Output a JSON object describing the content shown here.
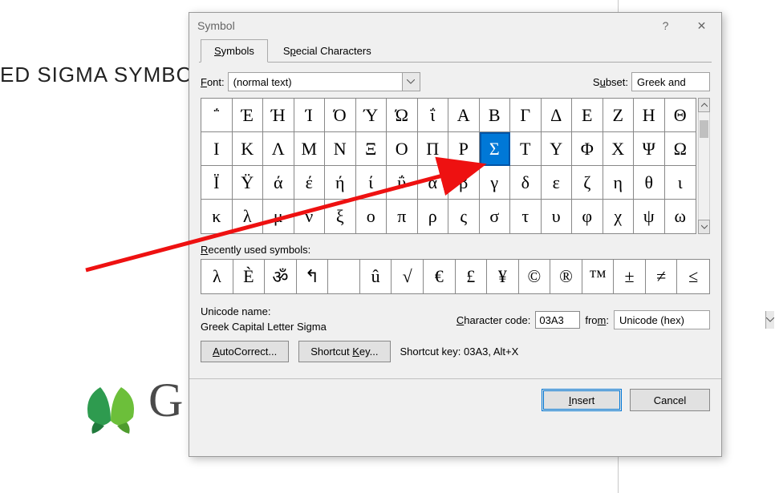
{
  "background": {
    "text_fragment": "ED SIGMA SYMBOL",
    "g_letter": "G"
  },
  "dialog": {
    "title": "Symbol",
    "tabs": {
      "symbols": "Symbols",
      "special": "Special Characters"
    },
    "font_label": "Font:",
    "font_value": "(normal text)",
    "subset_label": "Subset:",
    "subset_value": "Greek and",
    "grid": {
      "rows": [
        [
          "΅",
          "Έ",
          "Ή",
          "Ί",
          "Ό",
          "Ύ",
          "Ώ",
          "ΐ",
          "Α",
          "Β",
          "Γ",
          "Δ",
          "Ε",
          "Ζ",
          "Η",
          "Θ"
        ],
        [
          "Ι",
          "Κ",
          "Λ",
          "Μ",
          "Ν",
          "Ξ",
          "Ο",
          "Π",
          "Ρ",
          "Σ",
          "Τ",
          "Υ",
          "Φ",
          "Χ",
          "Ψ",
          "Ω"
        ],
        [
          "Ϊ",
          "Ϋ",
          "ά",
          "έ",
          "ή",
          "ί",
          "ΰ",
          "α",
          "β",
          "γ",
          "δ",
          "ε",
          "ζ",
          "η",
          "θ",
          "ι"
        ],
        [
          "κ",
          "λ",
          "μ",
          "ν",
          "ξ",
          "ο",
          "π",
          "ρ",
          "ς",
          "σ",
          "τ",
          "υ",
          "φ",
          "χ",
          "ψ",
          "ω"
        ]
      ],
      "selected_row": 1,
      "selected_col": 9
    },
    "recent_label": "Recently used symbols:",
    "recent": [
      "λ",
      "È",
      "ॐ",
      "↰",
      "",
      "û",
      "√",
      "€",
      "£",
      "¥",
      "©",
      "®",
      "™",
      "±",
      "≠",
      "≤"
    ],
    "unicode_name_label": "Unicode name:",
    "unicode_name_value": "Greek Capital Letter Sigma",
    "char_code_label": "Character code:",
    "char_code_value": "03A3",
    "from_label": "from:",
    "from_value": "Unicode (hex)",
    "autocorrect_btn": "AutoCorrect...",
    "shortcut_key_btn": "Shortcut Key...",
    "shortcut_key_text": "Shortcut key: 03A3, Alt+X",
    "insert_btn": "Insert",
    "cancel_btn": "Cancel"
  }
}
